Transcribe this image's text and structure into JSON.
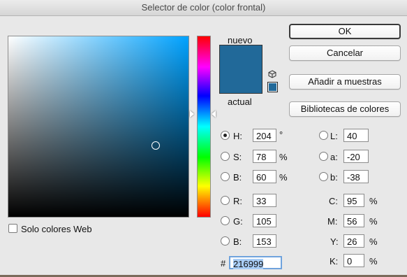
{
  "window": {
    "title": "Selector de color (color frontal)"
  },
  "swatch": {
    "new_label": "nuevo",
    "current_label": "actual",
    "new_color": "#216999",
    "current_color": "#216999"
  },
  "buttons": {
    "ok": "OK",
    "cancel": "Cancelar",
    "add_to_swatches": "Añadir a muestras",
    "color_libraries": "Bibliotecas de colores"
  },
  "hsb": {
    "h": {
      "label": "H:",
      "value": "204",
      "unit": "°",
      "selected": true
    },
    "s": {
      "label": "S:",
      "value": "78",
      "unit": "%"
    },
    "b": {
      "label": "B:",
      "value": "60",
      "unit": "%"
    }
  },
  "rgb": {
    "r": {
      "label": "R:",
      "value": "33"
    },
    "g": {
      "label": "G:",
      "value": "105"
    },
    "b": {
      "label": "B:",
      "value": "153"
    }
  },
  "lab": {
    "l": {
      "label": "L:",
      "value": "40"
    },
    "a": {
      "label": "a:",
      "value": "-20"
    },
    "b": {
      "label": "b:",
      "value": "-38"
    }
  },
  "cmyk": {
    "c": {
      "label": "C:",
      "value": "95",
      "unit": "%"
    },
    "m": {
      "label": "M:",
      "value": "56",
      "unit": "%"
    },
    "y": {
      "label": "Y:",
      "value": "26",
      "unit": "%"
    },
    "k": {
      "label": "K:",
      "value": "0",
      "unit": "%"
    }
  },
  "hex": {
    "label": "#",
    "value": "216999"
  },
  "web_only": {
    "label": "Solo colores Web",
    "checked": false
  }
}
